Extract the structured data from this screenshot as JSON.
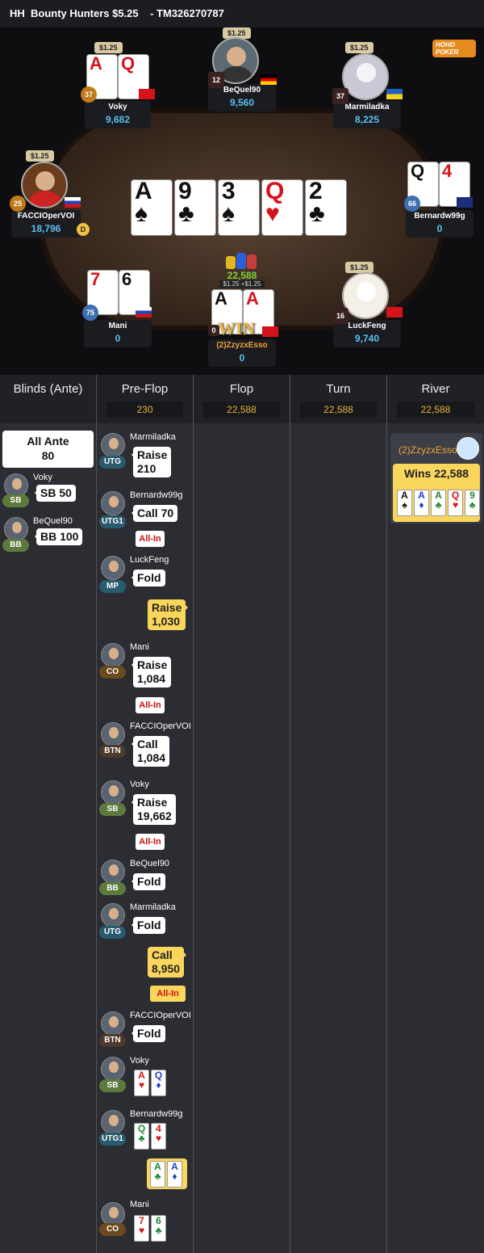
{
  "header": {
    "title": "HH  Bounty Hunters $5.25    - TM326270787"
  },
  "logo": {
    "text": "HOHO POKER"
  },
  "table": {
    "seats": [
      {
        "name": "Voky",
        "stack": "9,682",
        "bet": "$1.25",
        "level": "37",
        "cards": [
          "A",
          "Q"
        ]
      },
      {
        "name": "BeQuel90",
        "stack": "9,560",
        "bet": "$1.25",
        "level": "12"
      },
      {
        "name": "Marmiladka",
        "stack": "8,225",
        "bet": "$1.25",
        "level": "37"
      },
      {
        "name": "FACCIOperVOI",
        "stack": "18,796",
        "bet": "$1.25",
        "level": "25",
        "dealer": "D"
      },
      {
        "name": "Bernardw99g",
        "stack": "0",
        "level": "66",
        "cards": [
          "Q",
          "4"
        ]
      },
      {
        "name": "Mani",
        "stack": "0",
        "level": "75",
        "cards": [
          "7",
          "6"
        ]
      },
      {
        "name": "(2)ZzyzxEsso",
        "stack": "0",
        "level": "0",
        "cards": [
          "A",
          "A"
        ],
        "win": "WIN"
      },
      {
        "name": "LuckFeng",
        "stack": "9,740",
        "bet": "$1.25",
        "level": "16"
      }
    ],
    "board": [
      {
        "rank": "A",
        "suit": "♠"
      },
      {
        "rank": "9",
        "suit": "♣"
      },
      {
        "rank": "3",
        "suit": "♠"
      },
      {
        "rank": "Q",
        "suit": "♥"
      },
      {
        "rank": "2",
        "suit": "♣"
      }
    ],
    "pot": "22,588",
    "pot_sub": "$1.25 +$1.25"
  },
  "columns": [
    {
      "title": "Blinds (Ante)",
      "pot": ""
    },
    {
      "title": "Pre-Flop",
      "pot": "230"
    },
    {
      "title": "Flop",
      "pot": "22,588"
    },
    {
      "title": "Turn",
      "pot": "22,588"
    },
    {
      "title": "River",
      "pot": "22,588"
    }
  ],
  "blinds": {
    "ante_label": "All Ante",
    "ante_value": "80",
    "sb_name": "Voky",
    "sb_pos": "SB",
    "sb_text": "SB  50",
    "bb_name": "BeQuel90",
    "bb_pos": "BB",
    "bb_text": "BB  100"
  },
  "preflop": {
    "a1": {
      "name": "Marmiladka",
      "pos": "UTG",
      "line1": "Raise",
      "line2": "210"
    },
    "a2": {
      "name": "Bernardw99g",
      "pos": "UTG1",
      "line1": "Call  70",
      "allin": "All-In"
    },
    "a3": {
      "name": "LuckFeng",
      "pos": "MP",
      "line1": "Fold"
    },
    "h1": {
      "line1": "Raise",
      "line2": "1,030"
    },
    "a4": {
      "name": "Mani",
      "pos": "CO",
      "line1": "Raise",
      "line2": "1,084",
      "allin": "All-In"
    },
    "a5": {
      "name": "FACCIOperVOI",
      "pos": "BTN",
      "line1": "Call",
      "line2": "1,084"
    },
    "a6": {
      "name": "Voky",
      "pos": "SB",
      "line1": "Raise",
      "line2": "19,662",
      "allin": "All-In"
    },
    "a7": {
      "name": "BeQuel90",
      "pos": "BB",
      "line1": "Fold"
    },
    "a8": {
      "name": "Marmiladka",
      "pos": "UTG",
      "line1": "Fold"
    },
    "h2": {
      "line1": "Call",
      "line2": "8,950",
      "allin": "All-In"
    },
    "a9": {
      "name": "FACCIOperVOI",
      "pos": "BTN",
      "line1": "Fold"
    },
    "s1": {
      "name": "Voky",
      "pos": "SB",
      "c1": "A",
      "c2": "Q"
    },
    "s2": {
      "name": "Bernardw99g",
      "pos": "UTG1",
      "c1": "Q",
      "c2": "4"
    },
    "s3": {
      "c1": "A",
      "c2": "A"
    },
    "s4": {
      "name": "Mani",
      "pos": "CO",
      "c1": "7",
      "c2": "6"
    }
  },
  "river": {
    "winner": "(2)ZzyzxEsso",
    "wins": "Wins 22,588",
    "cards": [
      "A",
      "A",
      "A",
      "Q",
      "9"
    ],
    "suits": [
      "♠",
      "♦",
      "♣",
      "♥",
      "♣"
    ]
  },
  "colors": {
    "accent": "#fbd65c",
    "stack": "#5bc0ee",
    "pot": "#e7b33a"
  }
}
